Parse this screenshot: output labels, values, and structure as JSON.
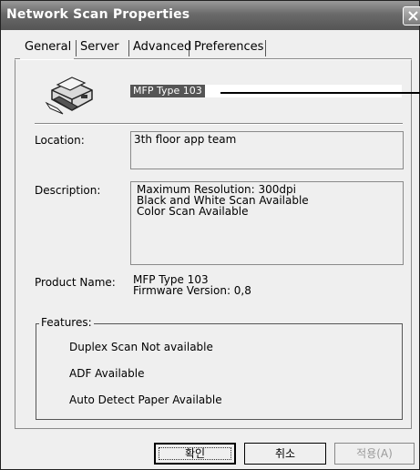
{
  "window": {
    "title": "Network Scan Properties"
  },
  "tabs": [
    {
      "label": "General",
      "active": true
    },
    {
      "label": "Server",
      "active": false
    },
    {
      "label": "Advanced",
      "active": false
    },
    {
      "label": "Preferences",
      "active": false
    }
  ],
  "general": {
    "device_name": "MFP Type 103",
    "location_label": "Location:",
    "location_value": "3th floor app team",
    "description_label": "Description:",
    "description_lines": [
      "Maximum Resolution: 300dpi",
      "Black and White Scan Available",
      "Color Scan Available"
    ],
    "product_name_label": "Product Name:",
    "product_name_lines": [
      "MFP Type 103",
      "Firmware Version: 0,8"
    ],
    "features_label": "Features:",
    "features": [
      "Duplex Scan Not available",
      "ADF Available",
      "Auto Detect Paper Available"
    ]
  },
  "buttons": {
    "ok": "확인",
    "cancel": "취소",
    "apply": "적용(A)"
  }
}
